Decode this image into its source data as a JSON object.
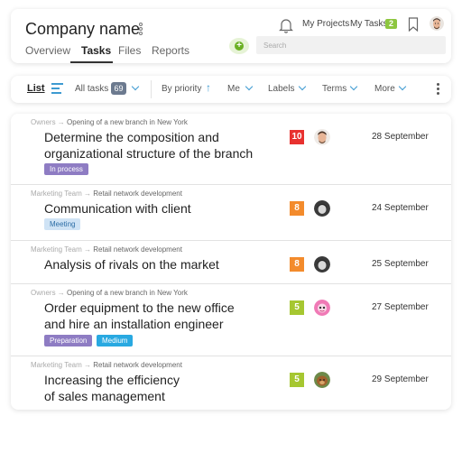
{
  "header": {
    "company_name": "Company name",
    "tabs": [
      {
        "label": "Overview",
        "active": false
      },
      {
        "label": "Tasks",
        "active": true
      },
      {
        "label": "Files",
        "active": false
      },
      {
        "label": "Reports",
        "active": false
      }
    ],
    "my_projects_label": "My Projects",
    "my_tasks_label": "My Tasks",
    "my_tasks_count": "2",
    "search_placeholder": "Search"
  },
  "toolbar": {
    "list_label": "List",
    "all_tasks_label": "All tasks",
    "all_tasks_count": "69",
    "sort_label": "By priority",
    "me_label": "Me",
    "labels_label": "Labels",
    "terms_label": "Terms",
    "more_label": "More"
  },
  "colors": {
    "accent": "#3d9ad1",
    "green": "#8dc63f",
    "priority_red": "#e8312f",
    "priority_orange": "#f38b2c",
    "priority_lime": "#a6c731"
  },
  "tasks": [
    {
      "crumb_team": "Owners",
      "crumb_project": "Opening of a new branch in New York",
      "title": "Determine the composition and\norganizational structure of the branch",
      "tags": [
        {
          "label": "In process",
          "bg": "#8e7cc3",
          "fg": "#ffffff"
        }
      ],
      "priority": "10",
      "priority_color": "#e8312f",
      "assignee_icon": "man-avatar-icon",
      "date": "28 September"
    },
    {
      "crumb_team": "Marketing Team",
      "crumb_project": "Retail network development",
      "title": "Communication with client",
      "tags": [
        {
          "label": "Meeting",
          "bg": "#cfe3f5",
          "fg": "#2d6ea6"
        }
      ],
      "priority": "8",
      "priority_color": "#f38b2c",
      "assignee_icon": "bw-avatar-icon",
      "date": "24 September"
    },
    {
      "crumb_team": "Marketing Team",
      "crumb_project": "Retail network development",
      "title": "Analysis of rivals on the market",
      "tags": [],
      "priority": "8",
      "priority_color": "#f38b2c",
      "assignee_icon": "bw-avatar-icon",
      "date": "25 September"
    },
    {
      "crumb_team": "Owners",
      "crumb_project": "Opening of a new branch in New York",
      "title": "Order equipment to the new office\n and hire an  installation engineer",
      "tags": [
        {
          "label": "Preparation",
          "bg": "#8e7cc3",
          "fg": "#ffffff"
        },
        {
          "label": "Medium",
          "bg": "#29a9e1",
          "fg": "#ffffff"
        }
      ],
      "priority": "5",
      "priority_color": "#a6c731",
      "assignee_icon": "pink-avatar-icon",
      "date": "27 September"
    },
    {
      "crumb_team": "Marketing Team",
      "crumb_project": "Retail network development",
      "title": "Increasing the efficiency\nof sales management",
      "tags": [],
      "priority": "5",
      "priority_color": "#a6c731",
      "assignee_icon": "dog-avatar-icon",
      "date": "29 September"
    }
  ]
}
